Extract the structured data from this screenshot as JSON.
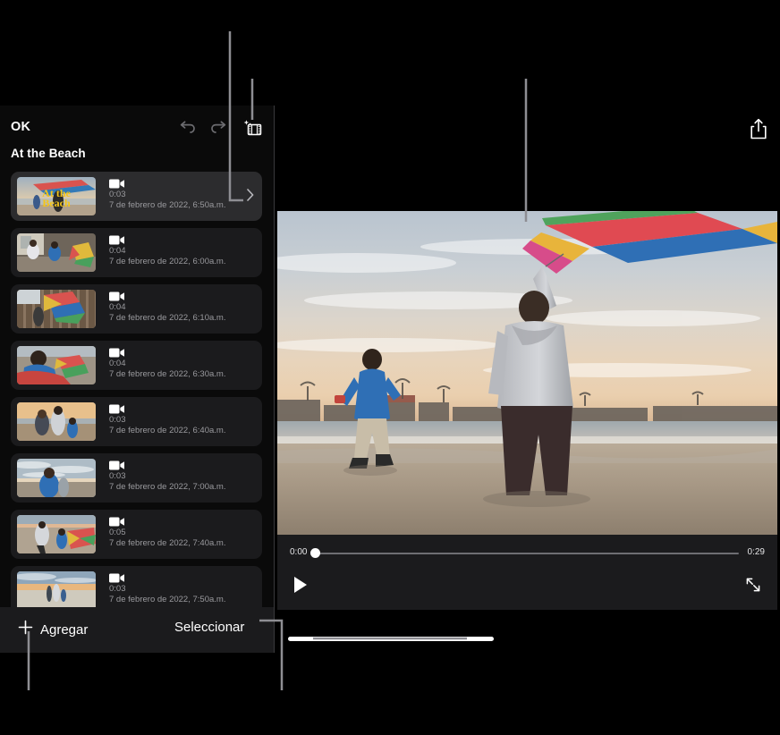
{
  "app": {
    "name": "iMovie project editor",
    "project_title": "At the Beach"
  },
  "sidebar": {
    "ok_label": "OK",
    "toolbar": [
      {
        "name": "undo-icon",
        "label": "Deshacer",
        "state": "dimmed"
      },
      {
        "name": "redo-icon",
        "label": "Rehacer",
        "state": "dimmed"
      },
      {
        "name": "add-media-icon",
        "label": "Agregar contenido",
        "state": "active"
      }
    ],
    "clips": [
      {
        "duration": "0:03",
        "date": "7 de febrero de 2022, 6:50a.m.",
        "selected": true,
        "overlay_title": "At the Beach",
        "scene": "title"
      },
      {
        "duration": "0:04",
        "date": "7 de febrero de 2022, 6:00a.m.",
        "selected": false,
        "overlay_title": "",
        "scene": "porch"
      },
      {
        "duration": "0:04",
        "date": "7 de febrero de 2022, 6:10a.m.",
        "selected": false,
        "overlay_title": "",
        "scene": "fence"
      },
      {
        "duration": "0:04",
        "date": "7 de febrero de 2022, 6:30a.m.",
        "selected": false,
        "overlay_title": "",
        "scene": "boykite"
      },
      {
        "duration": "0:03",
        "date": "7 de febrero de 2022, 6:40a.m.",
        "selected": false,
        "overlay_title": "",
        "scene": "family"
      },
      {
        "duration": "0:03",
        "date": "7 de febrero de 2022, 7:00a.m.",
        "selected": false,
        "overlay_title": "",
        "scene": "boyrun"
      },
      {
        "duration": "0:05",
        "date": "7 de febrero de 2022, 7:40a.m.",
        "selected": false,
        "overlay_title": "",
        "scene": "walkkite"
      },
      {
        "duration": "0:03",
        "date": "7 de febrero de 2022, 7:50a.m.",
        "selected": false,
        "overlay_title": "",
        "scene": "silhouette"
      }
    ],
    "bottom_bar": {
      "add_label": "Agregar",
      "select_label": "Seleccionar"
    }
  },
  "viewer": {
    "share_label": "Compartir",
    "player": {
      "current_time": "0:00",
      "total_time": "0:29",
      "play_label": "Reproducir",
      "fullscreen_label": "Pantalla completa",
      "progress_percent": 0
    }
  },
  "colors": {
    "window_background": "#000000",
    "sidebar_background": "#0a0a0a",
    "row_background": "#1b1b1d",
    "row_selected_background": "#2c2c2e",
    "bar_background": "#1b1b1d",
    "primary_text": "#ffffff",
    "secondary_text": "#9a9a9e",
    "divider": "#3a3a3c",
    "callout_line": "#8e8e93",
    "title_overlay": "#f5c518"
  }
}
